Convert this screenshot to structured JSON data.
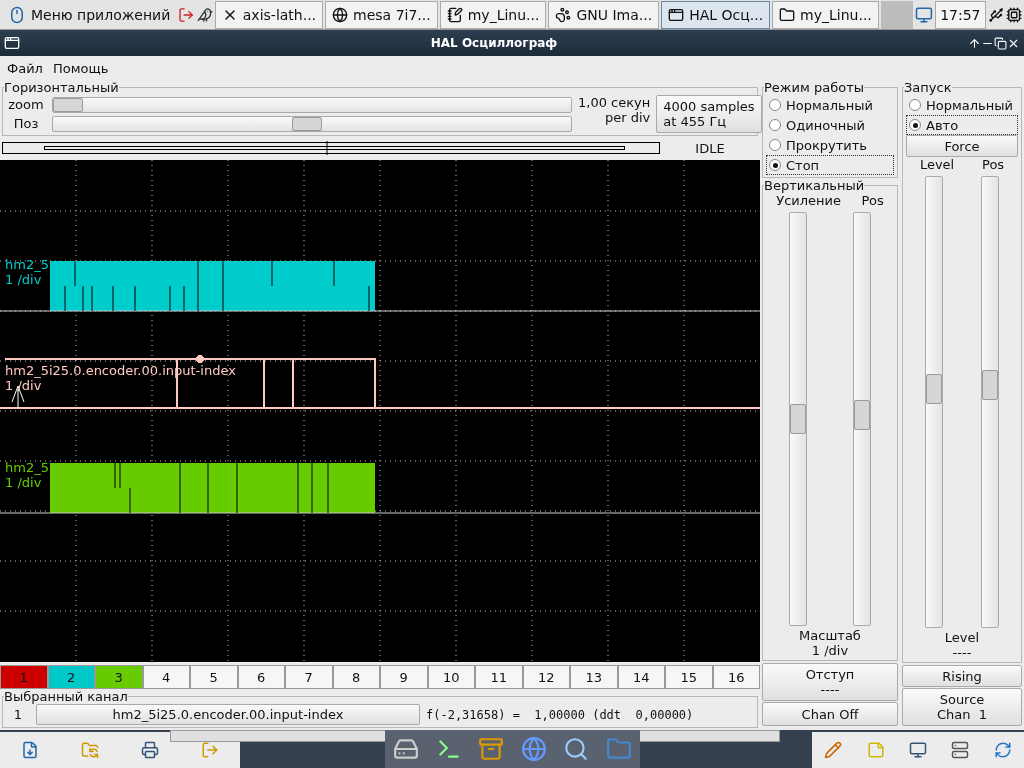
{
  "taskbar": {
    "menu_label": "Меню приложений",
    "tasks": [
      {
        "kind": "x",
        "label": "axis-lath...",
        "selected": false
      },
      {
        "kind": "globe",
        "label": "mesa 7i7...",
        "selected": false
      },
      {
        "kind": "notepad",
        "label": "my_Linu...",
        "selected": false
      },
      {
        "kind": "paw",
        "label": "GNU Ima...",
        "selected": false
      },
      {
        "kind": "window",
        "label": "HAL Осц...",
        "selected": true
      },
      {
        "kind": "folder",
        "label": "my_Linu...",
        "selected": false
      }
    ],
    "clock": "17:57"
  },
  "window": {
    "title": "HAL Осциллограф"
  },
  "menu": [
    "Файл",
    "Помощь"
  ],
  "horizontal": {
    "title": "Горизонтальный",
    "sliders": [
      {
        "label": "zoom",
        "level": 0
      },
      {
        "label": "Поз",
        "level": 0.49
      }
    ],
    "rate": [
      "1,00 секун",
      "per div"
    ],
    "samples": [
      "4000 samples",
      "at 455 Гц"
    ],
    "status": "IDLE"
  },
  "scope": {
    "traces": [
      {
        "name": "hm2_5",
        "scale": "1 /div",
        "color": "#00cccc"
      },
      {
        "name": "hm2_5i25.0.encoder.00.input-index",
        "scale": "1 /div",
        "color": "#ffc8c0"
      },
      {
        "name": "hm2_5",
        "scale": "1 /div",
        "color": "#66cc00"
      }
    ]
  },
  "channels": [
    {
      "label": "1",
      "color": "#cc0000"
    },
    {
      "label": "2",
      "color": "#00c8c8"
    },
    {
      "label": "3",
      "color": "#66cc00"
    },
    {
      "label": "4"
    },
    {
      "label": "5"
    },
    {
      "label": "6"
    },
    {
      "label": "7"
    },
    {
      "label": "8"
    },
    {
      "label": "9"
    },
    {
      "label": "10"
    },
    {
      "label": "11"
    },
    {
      "label": "12"
    },
    {
      "label": "13"
    },
    {
      "label": "14"
    },
    {
      "label": "15"
    },
    {
      "label": "16"
    }
  ],
  "selected_channel": {
    "title": "Выбранный канал",
    "number": "1",
    "name": "hm2_5i25.0.encoder.00.input-index",
    "readout": "f(-2,31658) =  1,00000 (ddt  0,00000)"
  },
  "mode": {
    "title": "Режим работы",
    "options": [
      {
        "label": "Нормальный",
        "selected": false
      },
      {
        "label": "Одиночный",
        "selected": false
      },
      {
        "label": "Прокрутить",
        "selected": false
      },
      {
        "label": "Стоп",
        "selected": true
      }
    ]
  },
  "vertical": {
    "title": "Вертикальный",
    "sliders": [
      {
        "label": "Усиление",
        "level": 0.5
      },
      {
        "label": "Pos",
        "level": 0.51
      }
    ],
    "scale_label": "Масштаб",
    "scale_value": "1 /div",
    "offset": [
      "Отступ",
      "----"
    ],
    "chan_off": "Chan Off"
  },
  "trigger": {
    "title": "Запуск",
    "options": [
      {
        "label": "Нормальный",
        "selected": false
      },
      {
        "label": "Авто",
        "selected": true
      }
    ],
    "force": "Force",
    "sliders": [
      {
        "label": "Level",
        "level": 0.53
      },
      {
        "label": "Pos",
        "level": 0.54
      }
    ],
    "level_label": "Level",
    "level_value": "----",
    "edge": "Rising",
    "source": [
      "Source",
      "Chan  1"
    ]
  }
}
